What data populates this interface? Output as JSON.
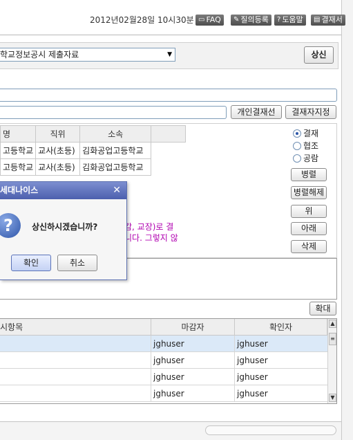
{
  "header": {
    "datetime": "2012년02월28일 10시30분",
    "buttons": [
      {
        "label": "FAQ",
        "icon": "chat-icon"
      },
      {
        "label": "질의등록",
        "icon": "pencil-icon"
      },
      {
        "label": "도움말",
        "icon": "question-icon"
      },
      {
        "label": "결재서",
        "icon": "document-icon"
      }
    ]
  },
  "doc": {
    "selected_type": "학교정보공시 제출자료",
    "submit_label": "상신"
  },
  "line": {
    "personal_label": "개인결재선",
    "assign_label": "결재자지정"
  },
  "approvers": {
    "headers": [
      "명",
      "직위",
      "소속"
    ],
    "rows": [
      {
        "name": "고등학교",
        "position": "교사(초등)",
        "dept": "김화공업고등학교"
      },
      {
        "name": "고등학교",
        "position": "교사(초등)",
        "dept": "김화공업고등학교"
      }
    ]
  },
  "options": {
    "approve": "결재",
    "cooperate": "협조",
    "view": "공람",
    "parallel": "병렬",
    "unparallel": "병렬해제",
    "up": "위",
    "down": "아래",
    "delete": "삭제"
  },
  "notice": {
    "line1": "감, 교장)로 결",
    "line2": "니다. 그렇지 않"
  },
  "expand_label": "확대",
  "grid": {
    "headers": {
      "item": "시항목",
      "closer": "마감자",
      "confirmer": "확인자"
    },
    "rows": [
      {
        "closer": "jghuser",
        "confirmer": "jghuser"
      },
      {
        "closer": "jghuser",
        "confirmer": "jghuser"
      },
      {
        "closer": "jghuser",
        "confirmer": "jghuser"
      },
      {
        "closer": "jghuser",
        "confirmer": "jghuser"
      }
    ]
  },
  "dialog": {
    "title": "세대나이스",
    "message": "상신하시겠습니까?",
    "ok": "확인",
    "cancel": "취소"
  }
}
